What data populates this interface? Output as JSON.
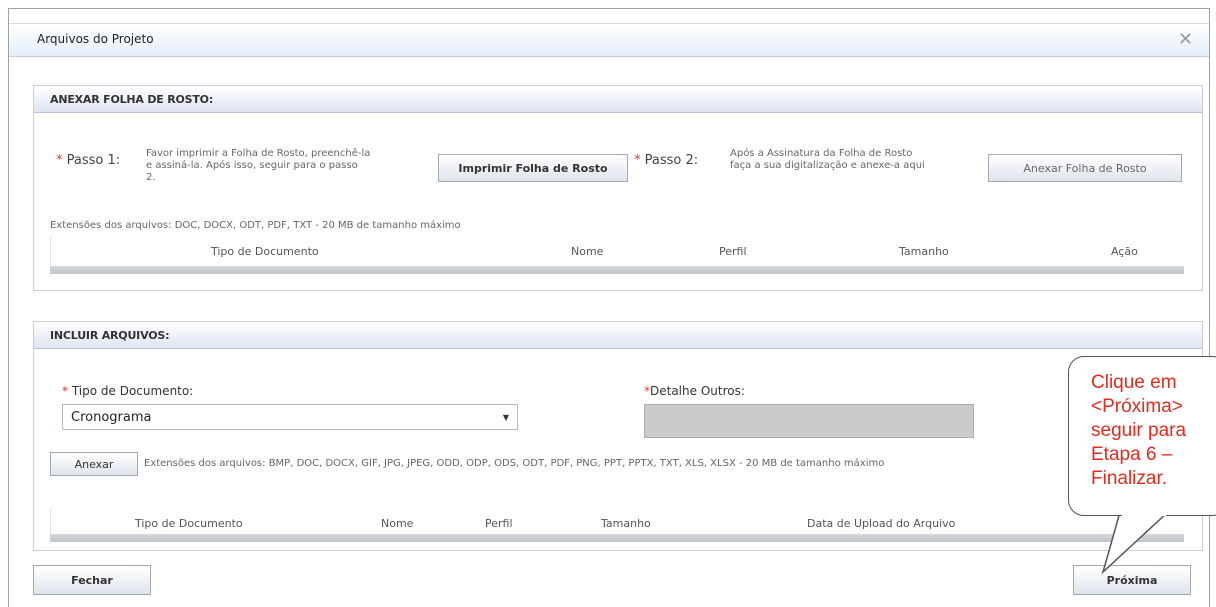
{
  "dialog": {
    "title": "Arquivos do Projeto"
  },
  "cover": {
    "header": "ANEXAR FOLHA DE ROSTO:",
    "step1": {
      "label": "Passo 1:",
      "lines": [
        "Favor imprimir a Folha de Rosto, preenchê-la",
        "e assiná-la. Após isso, seguir para o passo",
        "2."
      ]
    },
    "print_button": "Imprimir Folha de Rosto",
    "step2": {
      "label": "Passo 2:",
      "lines": [
        "Após a Assinatura da Folha de Rosto",
        "faça a sua digitalização e anexe-a aqui"
      ]
    },
    "attach_button": "Anexar Folha de Rosto",
    "extensions": "Extensões dos arquivos: DOC, DOCX, ODT, PDF, TXT - 20 MB de tamanho máximo",
    "columns": [
      "Tipo de Documento",
      "Nome",
      "Perfil",
      "Tamanho",
      "Ação"
    ]
  },
  "include": {
    "header": "INCLUIR ARQUIVOS:",
    "doc_type_label": "Tipo de Documento:",
    "doc_type_value": "Cronograma",
    "detail_label": "Detalhe Outros:",
    "attach_button": "Anexar",
    "extensions": "Extensões dos arquivos: BMP, DOC, DOCX, GIF, JPG, JPEG, ODD, ODP, ODS, ODT, PDF, PNG, PPT, PPTX, TXT, XLS, XLSX - 20 MB de tamanho máximo",
    "columns": [
      "Tipo de Documento",
      "Nome",
      "Perfil",
      "Tamanho",
      "Data de Upload do Arquivo"
    ]
  },
  "footer": {
    "close_button": "Fechar",
    "next_button": "Próxima"
  },
  "callout": {
    "lines": [
      "Clique em",
      "<Próxima>",
      "seguir para",
      "Etapa 6 –",
      "Finalizar."
    ]
  }
}
